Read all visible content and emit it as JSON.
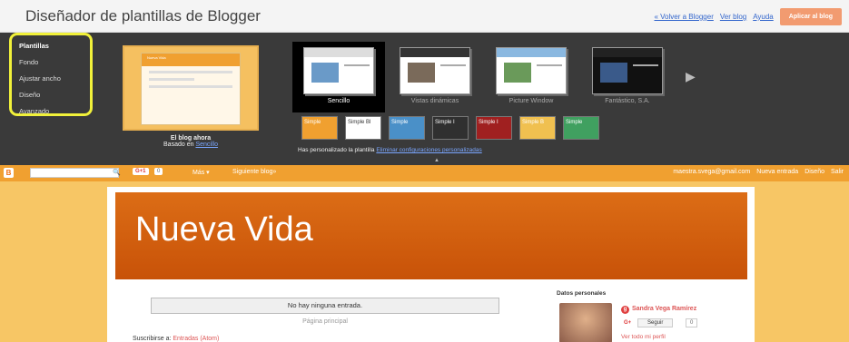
{
  "header": {
    "title": "Diseñador de plantillas de Blogger",
    "links": [
      "« Volver a Blogger",
      "Ver blog",
      "Ayuda"
    ],
    "apply_label": "Aplicar al blog"
  },
  "sidebar": {
    "items": [
      {
        "label": "Plantillas"
      },
      {
        "label": "Fondo"
      },
      {
        "label": "Ajustar ancho"
      },
      {
        "label": "Diseño"
      },
      {
        "label": "Avanzado"
      }
    ]
  },
  "current_blog": {
    "title": "El blog ahora",
    "based_on_prefix": "Basado en",
    "based_on_link": "Sencillo",
    "thumb_title": "Nueva Vida"
  },
  "templates": [
    {
      "name": "Sencillo",
      "selected": true
    },
    {
      "name": "Vistas dinámicas",
      "selected": false
    },
    {
      "name": "Picture Window",
      "selected": false
    },
    {
      "name": "Fantástico, S.A.",
      "selected": false
    }
  ],
  "variants": [
    {
      "label": "Simple",
      "bg": "#f0a030"
    },
    {
      "label": "Simple Bl",
      "bg": "#ffffff"
    },
    {
      "label": "Simple",
      "bg": "#4a90c8"
    },
    {
      "label": "Simple I",
      "bg": "#303030"
    },
    {
      "label": "Simple I",
      "bg": "#a02020"
    },
    {
      "label": "Simple B",
      "bg": "#f0c050"
    },
    {
      "label": "Simple",
      "bg": "#40a060"
    }
  ],
  "customized_note": {
    "text": "Has personalizado la plantilla",
    "link": "Eliminar configuraciones personalizadas"
  },
  "navbar": {
    "logo": "B",
    "gplus": "G+1",
    "count": "0",
    "more": "Más ▾",
    "next": "Siguiente blog»",
    "email": "maestra.svega@gmail.com",
    "new_post": "Nueva entrada",
    "design": "Diseño",
    "exit": "Salir"
  },
  "blog": {
    "title": "Nueva Vida",
    "no_entries": "No hay ninguna entrada.",
    "home_link": "Página principal",
    "subscribe_prefix": "Suscribirse a:",
    "subscribe_link": "Entradas (Atom)",
    "profile_heading": "Datos personales",
    "profile_name": "Sandra Vega Ramírez",
    "follow_label": "Seguir",
    "follow_count": "0",
    "profile_link": "Ver todo mi perfil"
  },
  "colors": {
    "accent_orange": "#f0a030",
    "header_orange": "#d7640d",
    "designer_bg": "#3a3a3a",
    "highlight_yellow": "#f1f13a"
  }
}
